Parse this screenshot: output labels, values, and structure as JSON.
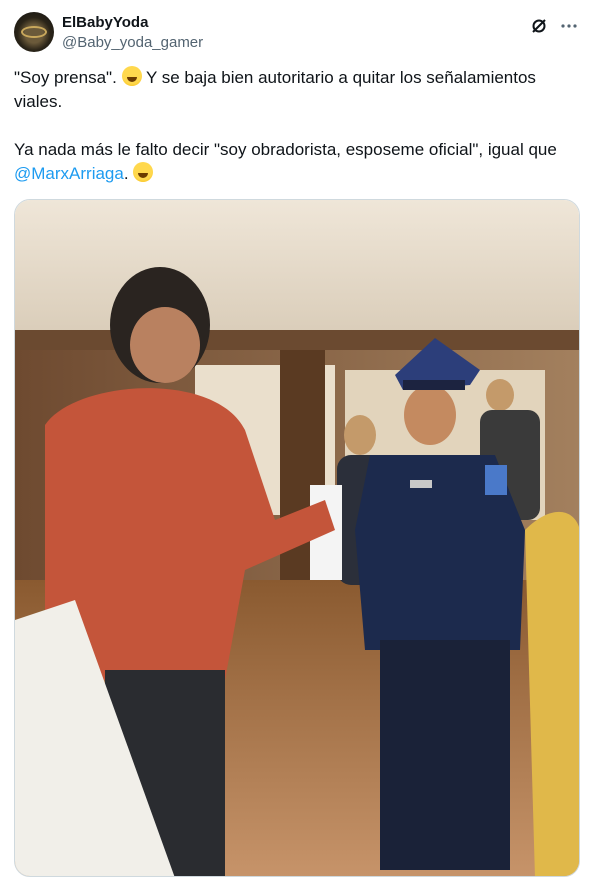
{
  "author": {
    "display_name": "ElBabyYoda",
    "handle": "@Baby_yoda_gamer"
  },
  "tweet": {
    "line1_part1": "\"Soy prensa\".",
    "line1_part2": " Y se baja bien autoritario a quitar los señalamientos viales.",
    "line2_part1": "Ya nada más le falto decir \"soy obradorista, esposeme oficial\", igual que ",
    "mention": "@MarxArriaga",
    "line2_part2": "."
  },
  "icons": {
    "grok": "grok-icon",
    "more": "more-icon",
    "emoji1": "laughing-tears-emoji-icon",
    "emoji2": "rolling-laughing-emoji-icon"
  },
  "colors": {
    "link": "#1d9bf0",
    "secondary_text": "#536471",
    "border": "#cfd9de"
  }
}
